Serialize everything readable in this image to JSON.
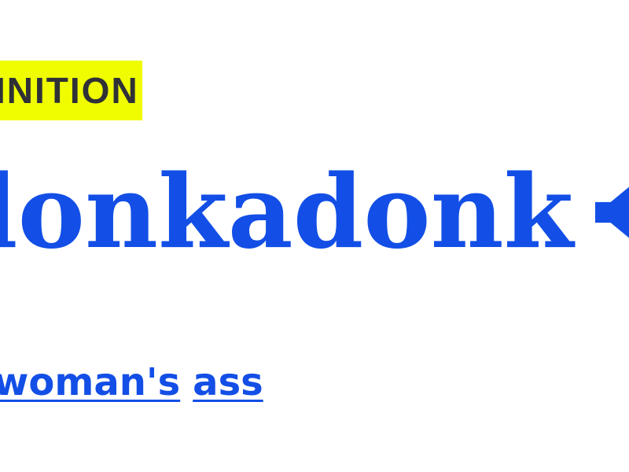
{
  "entry": {
    "label": "INITION",
    "word": "lonkadonk",
    "speaker_icon": "speaker-volume-icon",
    "meaning_links": [
      "woman's",
      "ass"
    ]
  },
  "colors": {
    "highlight": "#effd00",
    "link_blue": "#134fe6",
    "label_text": "#2f3137"
  }
}
